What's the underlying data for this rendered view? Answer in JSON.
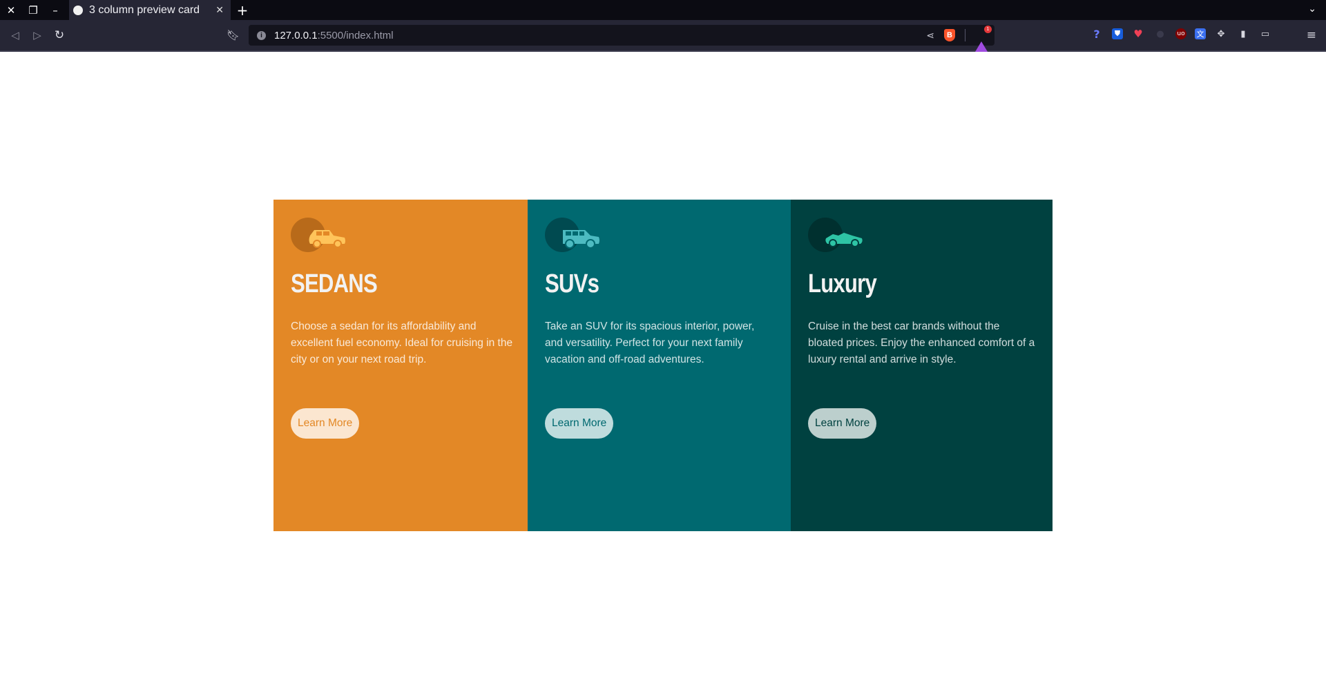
{
  "browser": {
    "tab_title": "3 column preview card",
    "url_host": "127.0.0.1",
    "url_path": ":5500/index.html",
    "window_controls": {
      "close": "close-icon",
      "restore": "restore-icon",
      "minimize": "minimize-icon"
    },
    "extensions": [
      "help-icon",
      "bitwarden-icon",
      "pocket-icon",
      "extension-icon",
      "ublock-icon",
      "translate-icon",
      "puzzle-icon",
      "sidebar-icon",
      "wallet-icon"
    ],
    "rewards_badge": "1"
  },
  "cards": [
    {
      "icon": "sedan-car-icon",
      "title": "SEDANS",
      "text": "Choose a sedan for its affordability and excellent fuel economy. Ideal for cruising in the city or on your next road trip.",
      "button": "Learn More",
      "color": "#e38826"
    },
    {
      "icon": "suv-car-icon",
      "title": "SUVs",
      "text": "Take an SUV for its spacious interior, power, and versatility. Perfect for your next family vacation and off-road adventures.",
      "button": "Learn More",
      "color": "#006970"
    },
    {
      "icon": "luxury-car-icon",
      "title": "Luxury",
      "text": "Cruise in the best car brands without the bloated prices. Enjoy the enhanced comfort of a luxury rental and arrive in style.",
      "button": "Learn More",
      "color": "#004140"
    }
  ]
}
